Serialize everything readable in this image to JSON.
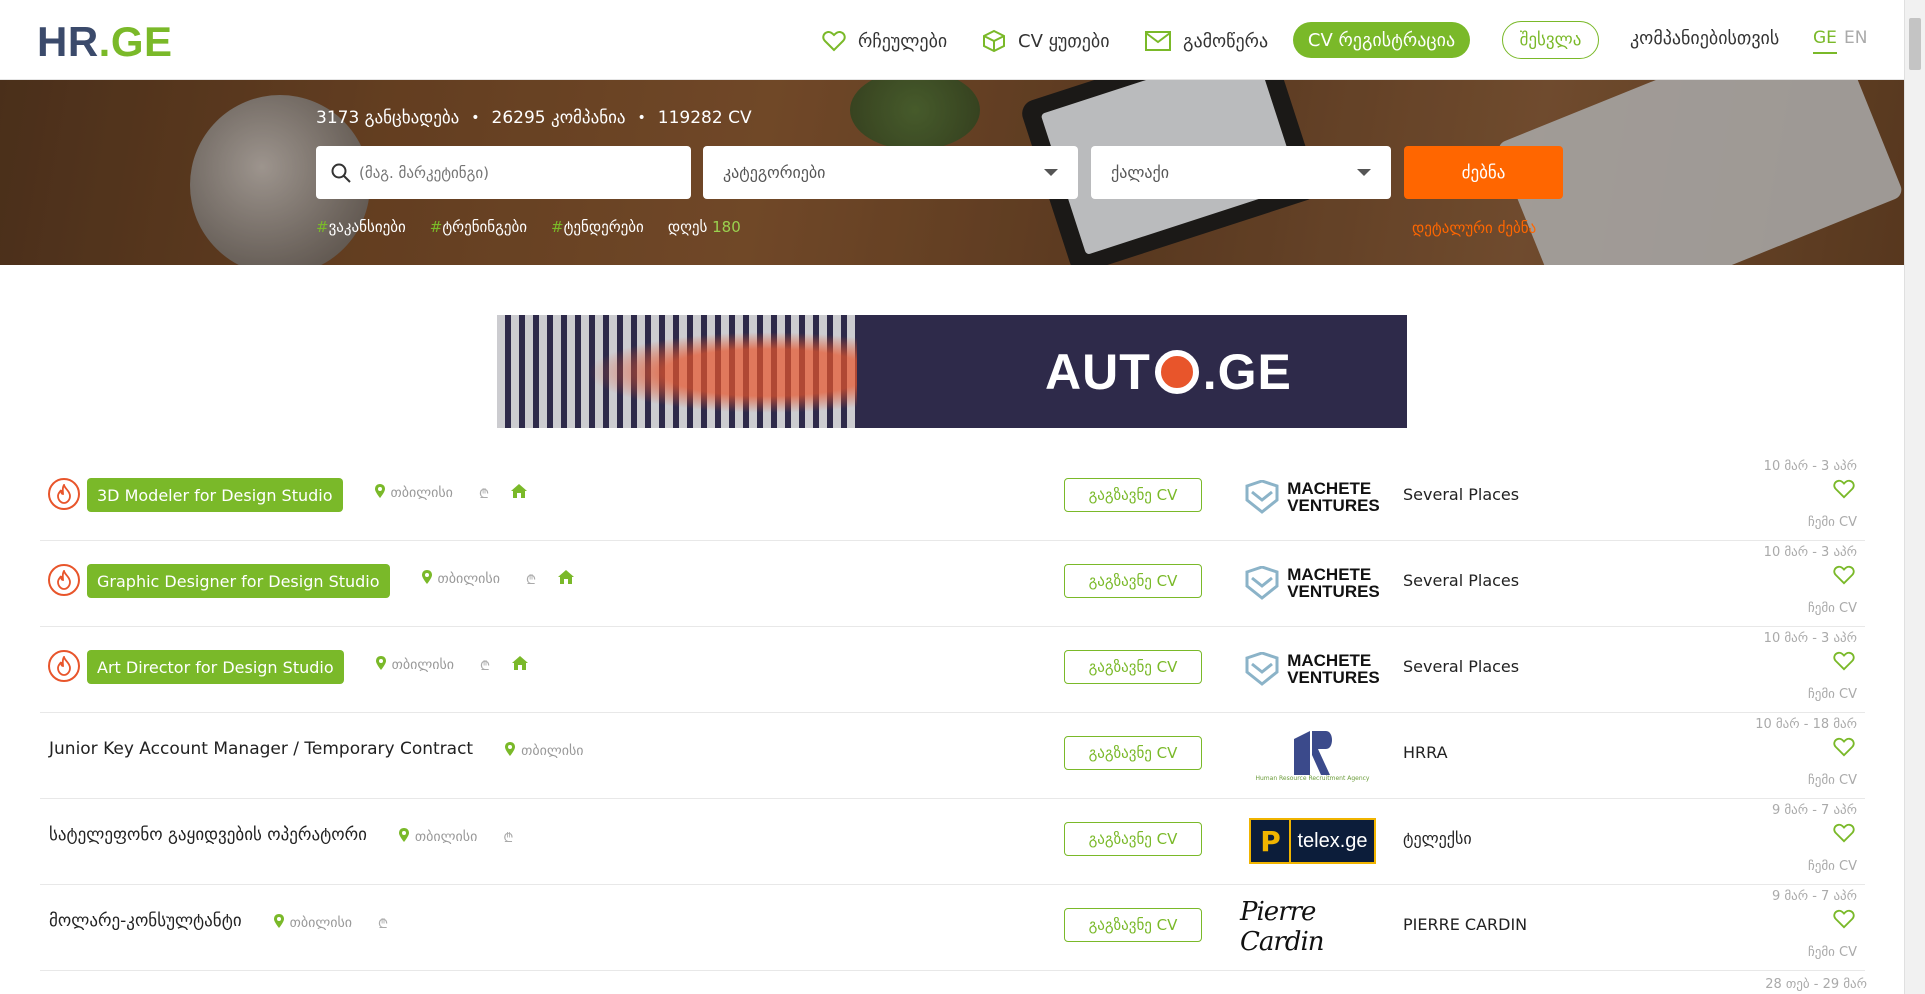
{
  "header": {
    "logo": {
      "hr": "HR",
      "dot": ".",
      "ge": "GE"
    },
    "nav": {
      "favorites": "რჩეულები",
      "cv_boxes": "CV ყუთები",
      "subscribe": "გამოწერა",
      "cv_register": "CV რეგისტრაცია",
      "login": "შესვლა",
      "for_companies": "კომპანიებისთვის"
    },
    "lang": {
      "ge": "GE",
      "en": "EN"
    }
  },
  "hero": {
    "stats": {
      "vacancies": "3173 განცხადება",
      "companies": "26295 კომპანია",
      "cvs": "119282 CV"
    },
    "search_placeholder": "(მაგ. მარკეტინგი)",
    "category_select": "კატეგორიები",
    "city_select": "ქალაქი",
    "search_button": "ძებნა",
    "tags": [
      {
        "hash": "#",
        "label": "ვაკანსიები"
      },
      {
        "hash": "#",
        "label": "ტრენინგები"
      },
      {
        "hash": "#",
        "label": "ტენდერები"
      }
    ],
    "today_label": "დღეს",
    "today_count": "180",
    "detailed_search": "დეტალური ძებნა"
  },
  "banner": {
    "text_left": "AUT",
    "text_right": ".GE"
  },
  "jobs": [
    {
      "title": "3D Modeler for Design Studio",
      "hot": true,
      "city": "თბილისი",
      "salary": true,
      "remote": true,
      "send_cv": "გაგზავნე CV",
      "logo": "machete",
      "logo_line1": "MACHETE",
      "logo_line2": "VENTURES",
      "company": "Several Places",
      "dates": "10 მარ - 3 აპრ",
      "my_cv": "ჩემი CV"
    },
    {
      "title": "Graphic Designer for Design Studio",
      "hot": true,
      "city": "თბილისი",
      "salary": true,
      "remote": true,
      "send_cv": "გაგზავნე CV",
      "logo": "machete",
      "logo_line1": "MACHETE",
      "logo_line2": "VENTURES",
      "company": "Several Places",
      "dates": "10 მარ - 3 აპრ",
      "my_cv": "ჩემი CV"
    },
    {
      "title": "Art Director for Design Studio",
      "hot": true,
      "city": "თბილისი",
      "salary": true,
      "remote": true,
      "send_cv": "გაგზავნე CV",
      "logo": "machete",
      "logo_line1": "MACHETE",
      "logo_line2": "VENTURES",
      "company": "Several Places",
      "dates": "10 მარ - 3 აპრ",
      "my_cv": "ჩემი CV"
    },
    {
      "title": "Junior Key Account Manager / Temporary Contract",
      "hot": false,
      "city": "თბილისი",
      "salary": false,
      "remote": false,
      "send_cv": "გაგზავნე CV",
      "logo": "hrra",
      "logo_sub": "Human Resource Recruitment Agency",
      "company": "HRRA",
      "dates": "10 მარ - 18 მარ",
      "my_cv": "ჩემი CV"
    },
    {
      "title": "სატელეფონო გაყიდვების ოპერატორი",
      "hot": false,
      "city": "თბილისი",
      "salary": true,
      "remote": false,
      "send_cv": "გაგზავნე CV",
      "logo": "telex",
      "logo_letter": "P",
      "logo_text": "telex.ge",
      "company": "ტელექსი",
      "dates": "9 მარ - 7 აპრ",
      "my_cv": "ჩემი CV"
    },
    {
      "title": "მოლარე-კონსულტანტი",
      "hot": false,
      "city": "თბილისი",
      "salary": true,
      "remote": false,
      "send_cv": "გაგზავნე CV",
      "logo": "pierre",
      "logo_text": "Pierre Cardin",
      "company": "PIERRE CARDIN",
      "dates": "9 მარ - 7 აპრ",
      "my_cv": "ჩემი CV"
    }
  ],
  "last_row_dates": "28 თებ - 29 მარ",
  "colors": {
    "green": "#7ab929",
    "orange": "#ff6600",
    "navy": "#3b4a6b"
  }
}
